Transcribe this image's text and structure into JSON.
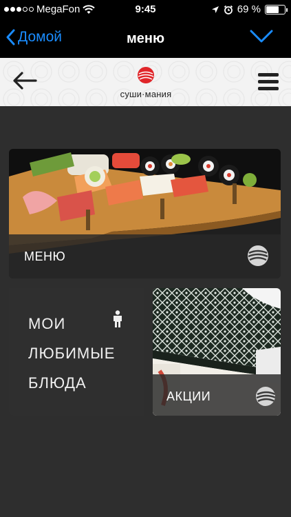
{
  "status_bar": {
    "carrier": "MegaFon",
    "time": "9:45",
    "battery": "69 %",
    "battery_level": 0.69
  },
  "nav_bar": {
    "back_label": "Домой",
    "title": "меню"
  },
  "app_header": {
    "logo_text": "суши·мания"
  },
  "tiles": {
    "menu": {
      "label": "МЕНЮ"
    },
    "favorites": {
      "line1": "МОИ",
      "line2": "ЛЮБИМЫЕ",
      "line3": "БЛЮДА"
    },
    "promo": {
      "label": "АКЦИИ"
    }
  },
  "colors": {
    "ios_blue": "#1a8cff",
    "logo_red": "#e0262a",
    "background": "#2e2e2e"
  }
}
